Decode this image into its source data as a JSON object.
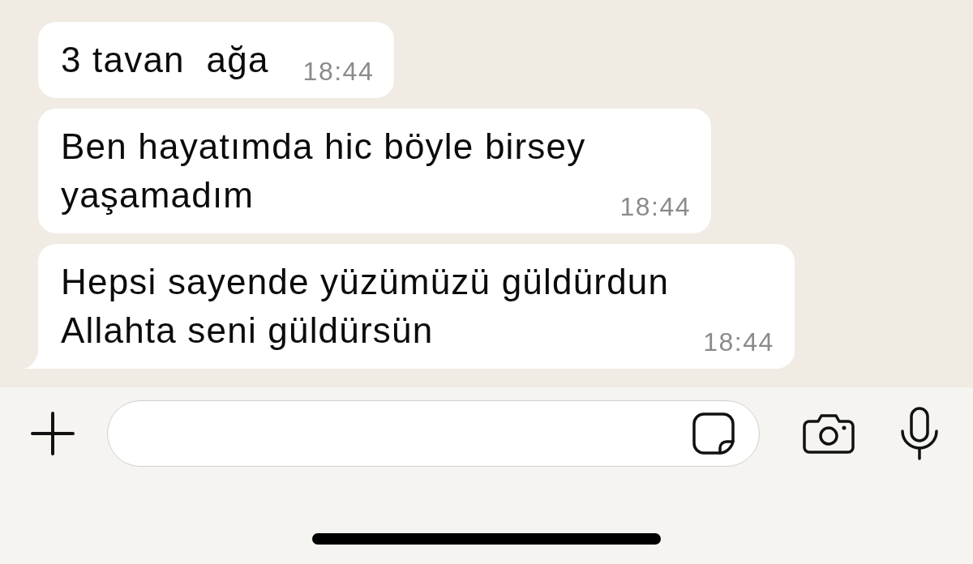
{
  "messages": [
    {
      "text": "3 tavan  ağa",
      "time": "18:44",
      "tail": false
    },
    {
      "text": "Ben hayatımda hic böyle birsey\nyaşamadım",
      "time": "18:44",
      "tail": false
    },
    {
      "text": "Hepsi sayende yüzümüzü güldürdun\nAllahta seni güldürsün",
      "time": "18:44",
      "tail": true
    }
  ]
}
